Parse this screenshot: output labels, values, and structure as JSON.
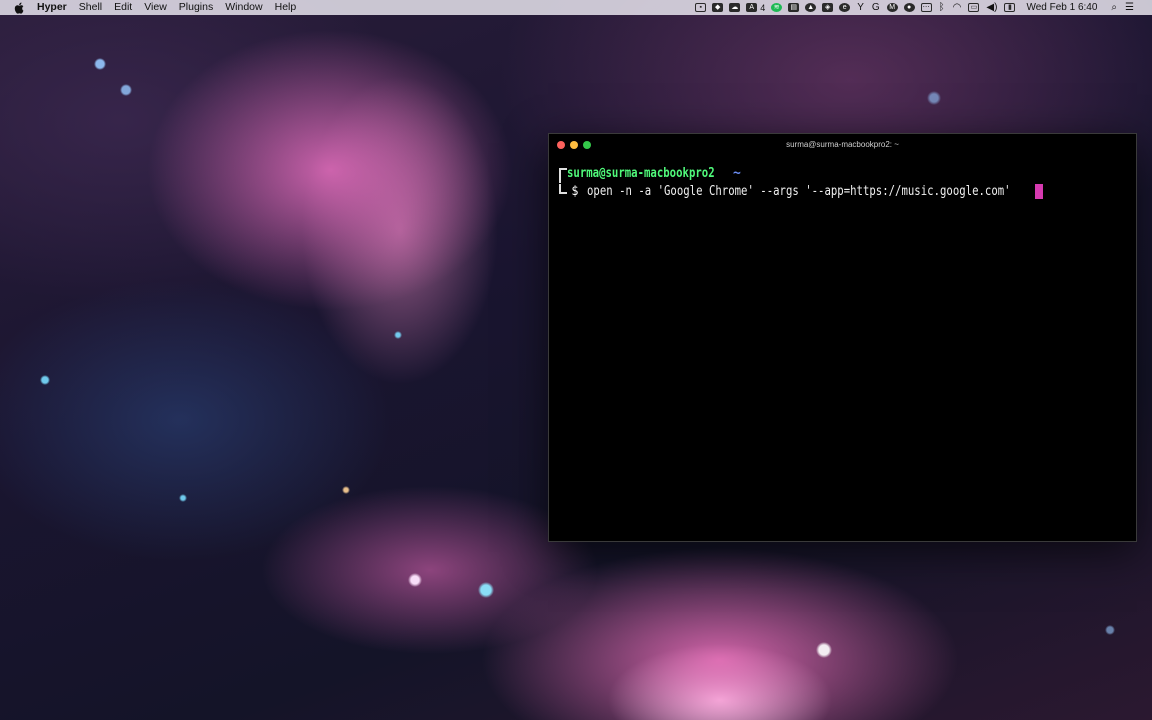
{
  "menubar": {
    "app_name": "Hyper",
    "menus": [
      "Shell",
      "Edit",
      "View",
      "Plugins",
      "Window",
      "Help"
    ],
    "tray": {
      "badge_count": "4",
      "clock": "Wed Feb 1  6:40",
      "icons": [
        "camera-icon",
        "dropbox-icon",
        "cloud-icon",
        "adobe-icon",
        "spotify-icon",
        "docker-icon",
        "drive-icon",
        "vpn-icon",
        "evernote-icon",
        "y-icon",
        "google-icon",
        "m-icon",
        "github-icon",
        "dots-icon",
        "bluetooth-icon",
        "wifi-icon",
        "airplay-icon",
        "volume-icon",
        "battery-icon",
        "search-icon",
        "notification-center-icon"
      ]
    }
  },
  "terminal": {
    "window_title": "surma@surma-macbookpro2: ~",
    "prompt_user": "surma@surma-macbookpro2",
    "prompt_cwd": "~",
    "prompt_symbol": "$",
    "command": "open -n -a 'Google Chrome' --args '--app=https://music.google.com'",
    "cursor_color": "#d63ab0",
    "user_color": "#50fa7b",
    "cwd_color": "#6c8ef5"
  }
}
